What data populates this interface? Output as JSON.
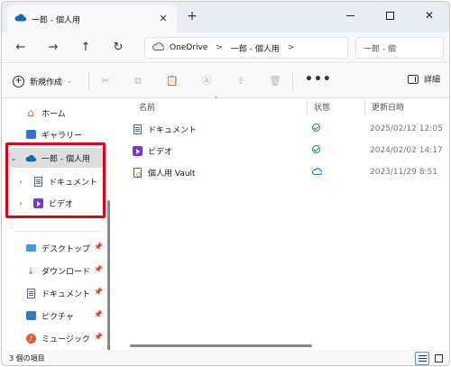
{
  "tab": {
    "title": "一郎 - 個人用",
    "close": "✕",
    "new_tab": "+"
  },
  "window_controls": {
    "close": "✕"
  },
  "nav": {
    "back": "←",
    "forward": "→",
    "up": "↑",
    "refresh": "↻"
  },
  "address": {
    "root": "OneDrive",
    "sep": ">",
    "current": "一郎 - 個人用",
    "trailing_sep": ">"
  },
  "search": {
    "placeholder": "一郎 - 個"
  },
  "command_bar": {
    "new_label": "新規作成",
    "new_chevron": "⌄",
    "more": "•••",
    "details_label": "詳細",
    "disabled_icons": [
      "cut-icon",
      "copy-icon",
      "paste-icon",
      "rename-icon",
      "share-icon",
      "delete-icon"
    ]
  },
  "sidebar": {
    "home": "ホーム",
    "gallery": "ギャラリー",
    "onedrive": "一郎 - 個人用",
    "onedrive_children": [
      {
        "label": "ドキュメント",
        "icon": "document-icon"
      },
      {
        "label": "ビデオ",
        "icon": "video-icon"
      }
    ],
    "quick_access": [
      {
        "label": "デスクトップ",
        "icon": "desktop-icon"
      },
      {
        "label": "ダウンロード",
        "icon": "download-icon"
      },
      {
        "label": "ドキュメント",
        "icon": "document-icon"
      },
      {
        "label": "ピクチャ",
        "icon": "pictures-icon"
      },
      {
        "label": "ミュージック",
        "icon": "music-icon"
      }
    ],
    "pin": "📌",
    "chevron_open": "⌄",
    "chevron_closed": "›"
  },
  "columns": {
    "name": "名前",
    "status": "状態",
    "modified": "更新日時"
  },
  "files": [
    {
      "name": "ドキュメント",
      "icon": "document-icon",
      "status": "synced",
      "date": "2025/02/12 12:05"
    },
    {
      "name": "ビデオ",
      "icon": "video-icon",
      "status": "synced",
      "date": "2024/02/02 14:17"
    },
    {
      "name": "個人用 Vault",
      "icon": "vault-icon",
      "status": "cloud",
      "date": "2023/11/29 8:51"
    }
  ],
  "status_bar": {
    "item_count": "3 個の項目"
  },
  "colors": {
    "highlight_box": "#e0001b",
    "onedrive_blue": "#0f6cbd",
    "synced_green": "#1e8f3c"
  }
}
